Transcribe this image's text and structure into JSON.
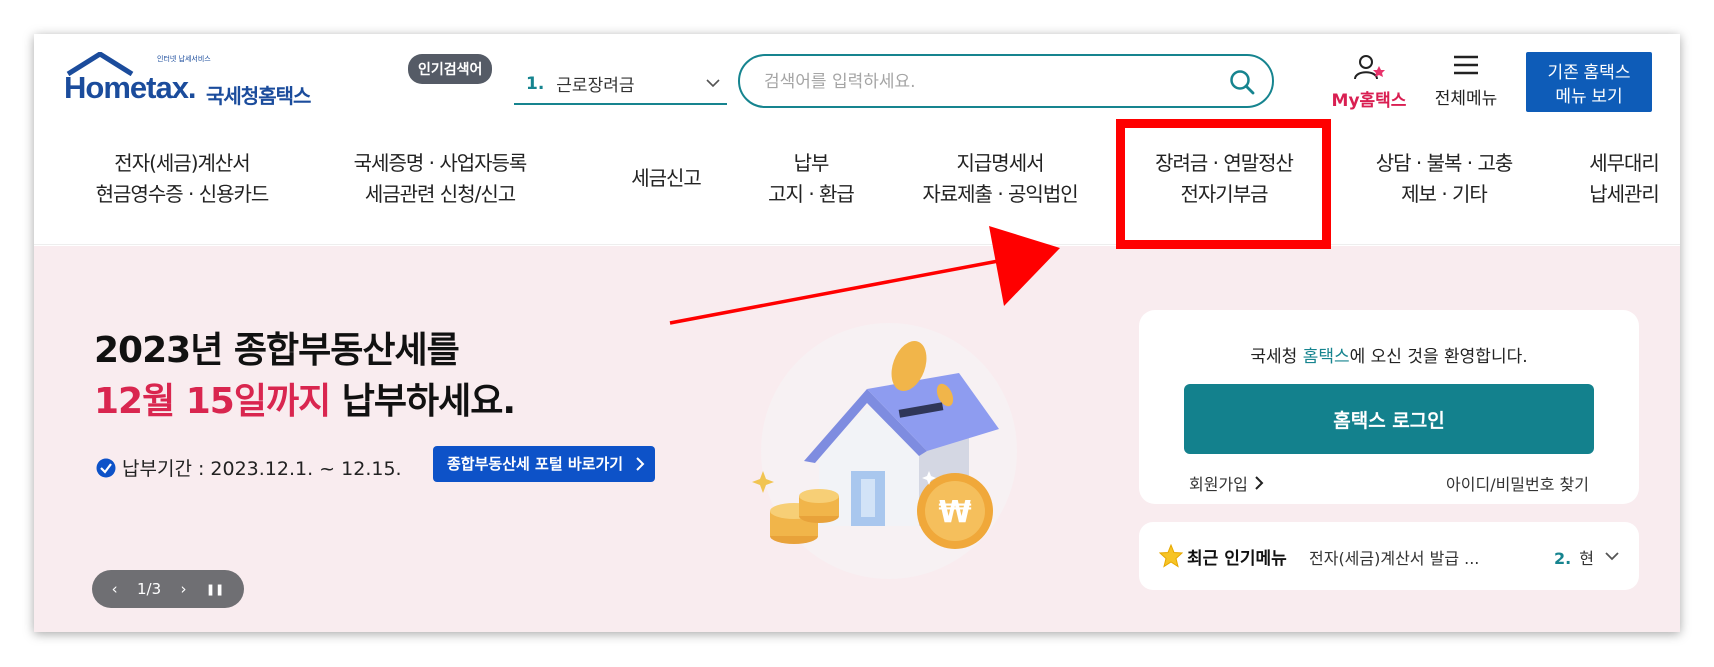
{
  "header": {
    "logo_tagline": "인터넷 납세서비스",
    "logo_text": "Hometax.",
    "logo_subtext": "국세청홈택스",
    "popular_tag": "인기검색어",
    "popular_num": "1.",
    "popular_keyword": "근로장려금",
    "search_placeholder": "검색어를 입력하세요.",
    "my_hometax": "My홈택스",
    "all_menu": "전체메뉴",
    "legacy_menu_line1": "기존 홈택스",
    "legacy_menu_line2": "메뉴 보기"
  },
  "gnb": [
    {
      "line1": "전자(세금)계산서",
      "line2": "현금영수증 · 신용카드"
    },
    {
      "line1": "국세증명 · 사업자등록",
      "line2": "세금관련 신청/신고"
    },
    {
      "line1": "세금신고",
      "line2": ""
    },
    {
      "line1": "납부",
      "line2": "고지 · 환급"
    },
    {
      "line1": "지급명세서",
      "line2": "자료제출 · 공익법인"
    },
    {
      "line1": "장려금 · 연말정산",
      "line2": "전자기부금"
    },
    {
      "line1": "상담 · 불복 · 고충",
      "line2": "제보 · 기타"
    },
    {
      "line1": "세무대리",
      "line2": "납세관리"
    }
  ],
  "banner": {
    "title_line1": "2023년 종합부동산세를",
    "title_highlight": "12월 15일까지",
    "title_rest": " 납부하세요.",
    "period": "납부기간 : 2023.12.1. ~ 12.15.",
    "portal_button": "종합부동산세 포털 바로가기",
    "pager_prev": "‹",
    "pager_text": "1/3",
    "pager_next": "›",
    "pager_pause": "❚❚"
  },
  "login": {
    "welcome_prefix": "국세청 ",
    "welcome_brand": "홈택스",
    "welcome_suffix": "에 오신 것을 환영합니다.",
    "login_button": "홈택스 로그인",
    "signup": "회원가입",
    "find_id": "아이디/비밀번호 찾기"
  },
  "recent": {
    "title": "최근 인기메뉴",
    "item1": "전자(세금)계산서 발급 ...",
    "item2_num": "2.",
    "item2": "현"
  },
  "colors": {
    "brand_teal": "#16848f",
    "legacy_blue": "#0e5cb8",
    "highlight_red": "#ff0000",
    "banner_bg": "#f9ecef",
    "accent_pink": "#d9264f"
  }
}
